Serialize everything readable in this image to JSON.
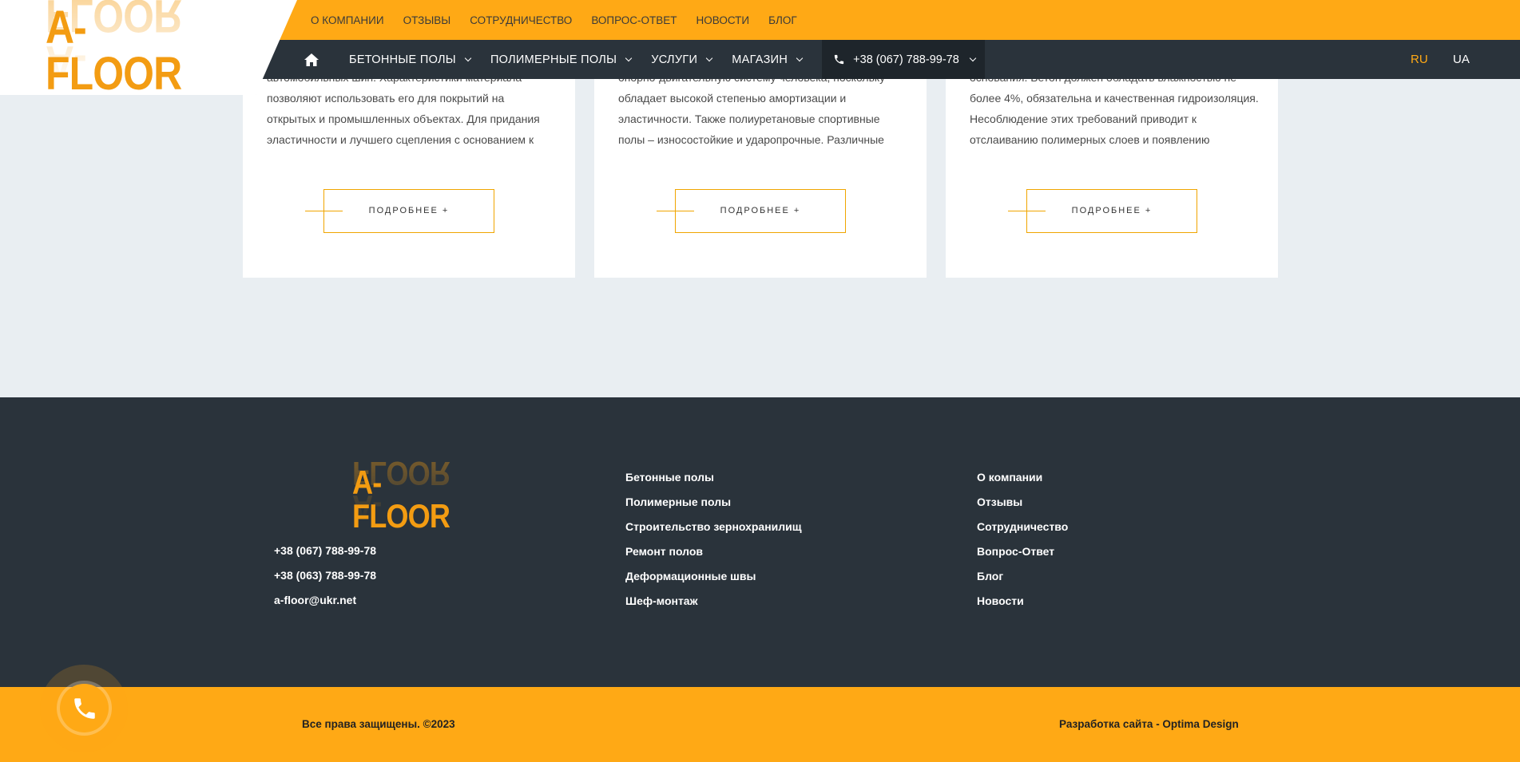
{
  "header": {
    "logo": "A-FLOOR",
    "top_nav": [
      "О КОМПАНИИ",
      "ОТЗЫВЫ",
      "СОТРУДНИЧЕСТВО",
      "ВОПРОС-ОТВЕТ",
      "НОВОСТИ",
      "БЛОГ"
    ],
    "main_nav": [
      "БЕТОННЫЕ ПОЛЫ",
      "ПОЛИМЕРНЫЕ ПОЛЫ",
      "УСЛУГИ",
      "МАГАЗИН"
    ],
    "phone": "+38 (067) 788-99-78",
    "languages": [
      {
        "code": "RU",
        "color": "#ffa915"
      },
      {
        "code": "UA",
        "color": "#ffffff"
      }
    ]
  },
  "cards": [
    {
      "lines": [
        "автомобильных шин. Характеристики материала",
        "позволяют использовать его для покрытий на",
        "открытых и промышленных объектах. Для придания",
        "эластичности и лучшего сцепления с основанием к"
      ],
      "button": "ПОДРОБНЕЕ +"
    },
    {
      "lines": [
        "опорно-двигательную систему человека, поскольку",
        "обладает высокой степенью амортизации и",
        "эластичности. Также полиуретановые спортивные",
        "полы – износостойкие и ударопрочные. Различные"
      ],
      "button": "ПОДРОБНЕЕ +"
    },
    {
      "lines": [
        "основания. Бетон должен обладать влажностью не",
        "более 4%, обязательна и качественная гидроизоляция.",
        "Несоблюдение этих требований приводит к",
        "отслаиванию полимерных слоев и появлению"
      ],
      "button": "ПОДРОБНЕЕ +"
    }
  ],
  "footer": {
    "logo": "A-FLOOR",
    "contacts": [
      "+38 (067) 788-99-78",
      "+38 (063) 788-99-78",
      "a-floor@ukr.net"
    ],
    "services": [
      "Бетонные полы",
      "Полимерные полы",
      "Строительство зернохранилищ",
      "Ремонт полов",
      "Деформационные швы",
      "Шеф-монтаж"
    ],
    "company": [
      "О компании",
      "Отзывы",
      "Сотрудничество",
      "Вопрос-Ответ",
      "Блог",
      "Новости"
    ],
    "copyright": "Все права защищены. ©2023",
    "developer": "Разработка сайта - Optima Design"
  },
  "colors": {
    "accent": "#ffa915",
    "logo_orange": "#f39c12",
    "dark": "#2a333b",
    "page_bg": "#e9eef2"
  },
  "icons": [
    "home-icon",
    "phone-icon",
    "chevron-down-icon",
    "call-icon"
  ]
}
